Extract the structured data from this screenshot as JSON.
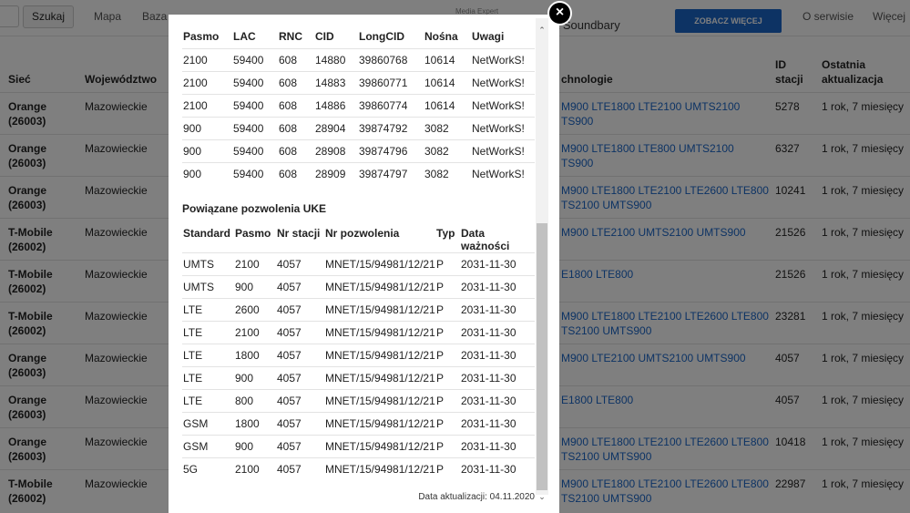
{
  "topbar": {
    "search_button": "Szukaj",
    "nav": [
      "Mapa",
      "Baza"
    ],
    "ad_small": "Media Expert",
    "ad_title": "a Soundbary",
    "cta": "ZOBACZ WIĘCEJ",
    "about": "O serwisie",
    "more": "Więcej"
  },
  "bg_table": {
    "headers": {
      "network": "Sieć",
      "province": "Województwo",
      "tech": "chnologie",
      "station_id_1": "ID",
      "station_id_2": "stacji",
      "last_update_1": "Ostatnia",
      "last_update_2": "aktualizacja"
    },
    "rows": [
      {
        "net1": "Orange",
        "net2": "(26003)",
        "prov": "Mazowieckie",
        "t1": "M900 LTE1800 LTE2100 UMTS2100",
        "t2": "TS900",
        "id": "5278",
        "upd": "1 rok, 7 miesięcy"
      },
      {
        "net1": "Orange",
        "net2": "(26003)",
        "prov": "Mazowieckie",
        "t1": "M900 LTE1800 LTE800 UMTS2100",
        "t2": "TS900",
        "id": "6327",
        "upd": "1 rok, 7 miesięcy"
      },
      {
        "net1": "Orange",
        "net2": "(26003)",
        "prov": "Mazowieckie",
        "t1": "M900 LTE1800 LTE2100 LTE2600 LTE800",
        "t2": "TS2100 UMTS900",
        "id": "10241",
        "upd": "1 rok, 7 miesięcy"
      },
      {
        "net1": "T-Mobile",
        "net2": "(26002)",
        "prov": "Mazowieckie",
        "t1": "M900 LTE2100 UMTS2100 UMTS900",
        "t2": "",
        "id": "21526",
        "upd": "1 rok, 7 miesięcy"
      },
      {
        "net1": "T-Mobile",
        "net2": "(26002)",
        "prov": "Mazowieckie",
        "t1": "E1800 LTE800",
        "t2": "",
        "id": "21526",
        "upd": "1 rok, 7 miesięcy"
      },
      {
        "net1": "T-Mobile",
        "net2": "(26002)",
        "prov": "Mazowieckie",
        "t1": "M900 LTE1800 LTE2100 LTE2600 LTE800",
        "t2": "TS2100 UMTS900",
        "id": "23281",
        "upd": "1 rok, 7 miesięcy"
      },
      {
        "net1": "Orange",
        "net2": "(26003)",
        "prov": "Mazowieckie",
        "t1": "M900 LTE2100 UMTS2100 UMTS900",
        "t2": "",
        "id": "4057",
        "upd": "1 rok, 7 miesięcy"
      },
      {
        "net1": "Orange",
        "net2": "(26003)",
        "prov": "Mazowieckie",
        "t1": "E1800 LTE800",
        "t2": "",
        "id": "4057",
        "upd": "1 rok, 7 miesięcy"
      },
      {
        "net1": "Orange",
        "net2": "(26003)",
        "prov": "Mazowieckie",
        "t1": "M900 LTE1800 LTE2100 LTE2600 LTE800",
        "t2": "TS2100 UMTS900",
        "id": "10418",
        "upd": "1 rok, 7 miesięcy"
      },
      {
        "net1": "T-Mobile",
        "net2": "(26002)",
        "prov": "Mazowieckie",
        "t1": "M900 LTE1800 LTE2100 LTE2600 LTE800",
        "t2": "TS2100 UMTS900",
        "id": "22987",
        "upd": "1 rok, 7 miesięcy"
      }
    ]
  },
  "modal": {
    "cells": {
      "headers": [
        "Pasmo",
        "LAC",
        "RNC",
        "CID",
        "LongCID",
        "Nośna",
        "Uwagi"
      ],
      "rows": [
        [
          "2100",
          "59400",
          "608",
          "14880",
          "39860768",
          "10614",
          "NetWorkS!"
        ],
        [
          "2100",
          "59400",
          "608",
          "14883",
          "39860771",
          "10614",
          "NetWorkS!"
        ],
        [
          "2100",
          "59400",
          "608",
          "14886",
          "39860774",
          "10614",
          "NetWorkS!"
        ],
        [
          "900",
          "59400",
          "608",
          "28904",
          "39874792",
          "3082",
          "NetWorkS!"
        ],
        [
          "900",
          "59400",
          "608",
          "28908",
          "39874796",
          "3082",
          "NetWorkS!"
        ],
        [
          "900",
          "59400",
          "608",
          "28909",
          "39874797",
          "3082",
          "NetWorkS!"
        ]
      ]
    },
    "uke_title": "Powiązane pozwolenia UKE",
    "permits": {
      "headers": [
        "Standard",
        "Pasmo",
        "Nr stacji",
        "Nr pozwolenia",
        "Typ",
        "Data ważności"
      ],
      "rows": [
        [
          "UMTS",
          "2100",
          "4057",
          "MNET/15/94981/12/21",
          "P",
          "2031-11-30"
        ],
        [
          "UMTS",
          "900",
          "4057",
          "MNET/15/94981/12/21",
          "P",
          "2031-11-30"
        ],
        [
          "LTE",
          "2600",
          "4057",
          "MNET/15/94981/12/21",
          "P",
          "2031-11-30"
        ],
        [
          "LTE",
          "2100",
          "4057",
          "MNET/15/94981/12/21",
          "P",
          "2031-11-30"
        ],
        [
          "LTE",
          "1800",
          "4057",
          "MNET/15/94981/12/21",
          "P",
          "2031-11-30"
        ],
        [
          "LTE",
          "900",
          "4057",
          "MNET/15/94981/12/21",
          "P",
          "2031-11-30"
        ],
        [
          "LTE",
          "800",
          "4057",
          "MNET/15/94981/12/21",
          "P",
          "2031-11-30"
        ],
        [
          "GSM",
          "1800",
          "4057",
          "MNET/15/94981/12/21",
          "P",
          "2031-11-30"
        ],
        [
          "GSM",
          "900",
          "4057",
          "MNET/15/94981/12/21",
          "P",
          "2031-11-30"
        ],
        [
          "5G",
          "2100",
          "4057",
          "MNET/15/94981/12/21",
          "P",
          "2031-11-30"
        ]
      ]
    },
    "updated": "Data aktualizacji: 04.11.2020",
    "close_symbol": "×",
    "scroll_up": "⌃",
    "scroll_down": "⌄"
  }
}
